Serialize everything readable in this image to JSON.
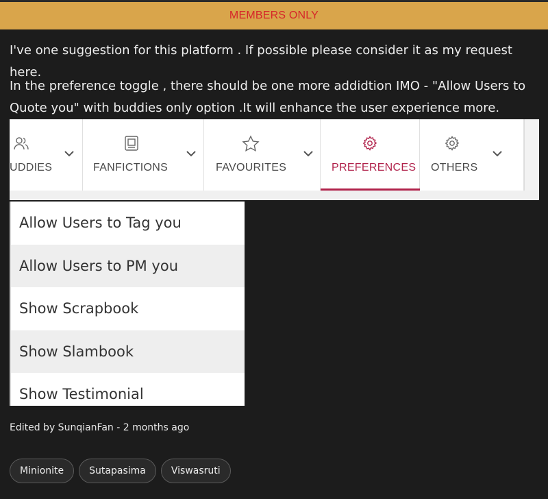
{
  "banner": {
    "text": "MEMBERS ONLY"
  },
  "post": {
    "paragraph1": "I've one suggestion for this platform . If possible please consider it as my request here.",
    "paragraph2": "In the preference toggle , there should be one more addidtion IMO - \"Allow Users to Quote you\" with buddies only option .It will enhance the user experience more."
  },
  "tabs": [
    {
      "label": "UDDIES",
      "icon": "users-icon"
    },
    {
      "label": "FANFICTIONS",
      "icon": "book-icon"
    },
    {
      "label": "FAVOURITES",
      "icon": "star-icon"
    },
    {
      "label": "PREFERENCES",
      "icon": "gear-icon",
      "active": true
    },
    {
      "label": "OTHERS",
      "icon": "gear-icon"
    }
  ],
  "menu": {
    "items": [
      "Allow Users to Tag you",
      "Allow Users to PM you",
      "Show Scrapbook",
      "Show Slambook",
      "Show Testimonial"
    ]
  },
  "meta": {
    "edited": "Edited by SunqianFan - 2 months ago"
  },
  "tags": [
    "Minionite",
    "Sutapasima",
    "Viswasruti"
  ],
  "colors": {
    "banner": "#d9a54b",
    "banner_text": "#d6262a",
    "accent": "#b0214a",
    "background": "#1c1c1c"
  }
}
